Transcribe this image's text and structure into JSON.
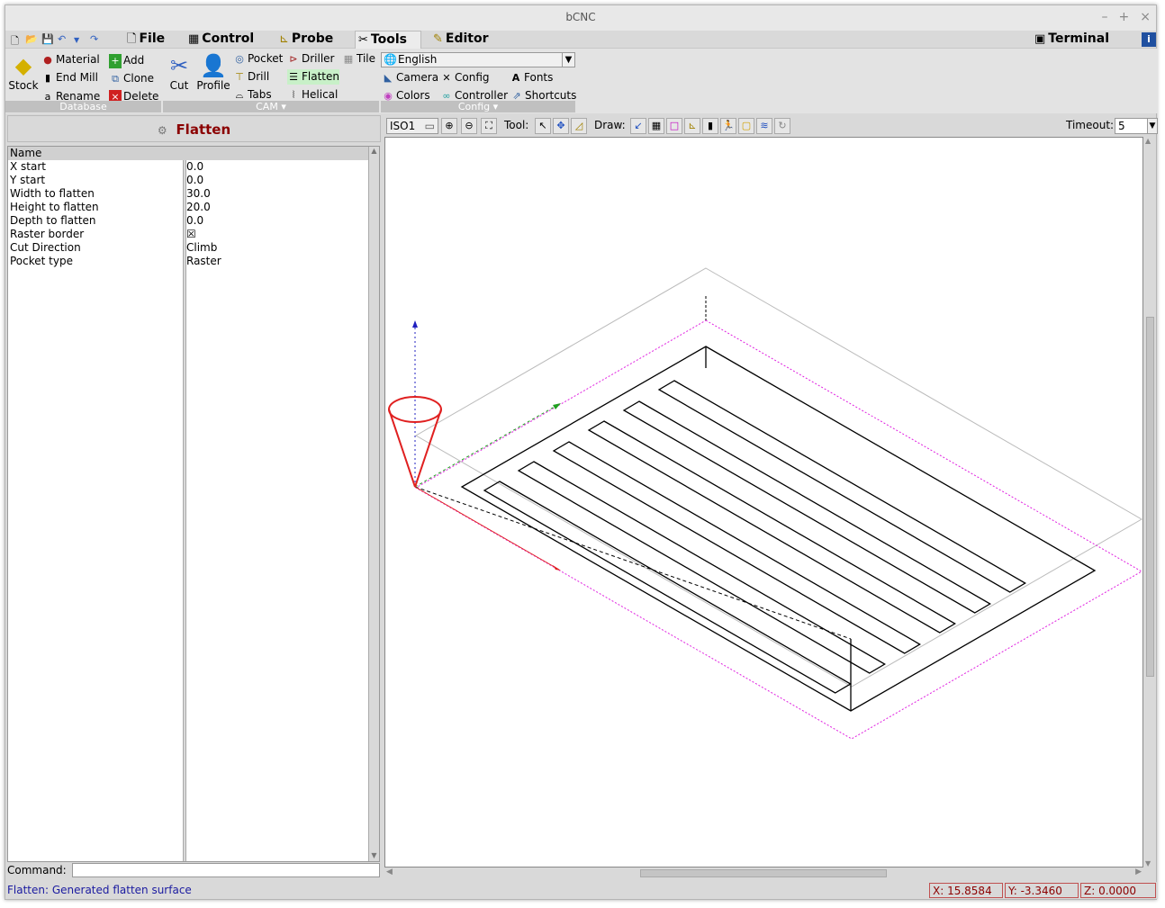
{
  "window": {
    "title": "bCNC"
  },
  "menu": {
    "tabs": [
      {
        "label": "File"
      },
      {
        "label": "Control"
      },
      {
        "label": "Probe"
      },
      {
        "label": "Tools"
      },
      {
        "label": "Editor"
      }
    ],
    "terminal": "Terminal"
  },
  "ribbon": {
    "database": {
      "group_label": "Database",
      "stock": "Stock",
      "material": "Material",
      "end_mill": "End Mill",
      "rename": "Rename",
      "add": "Add",
      "clone": "Clone",
      "delete": "Delete"
    },
    "cam": {
      "group_label": "CAM",
      "cut": "Cut",
      "profile": "Profile",
      "pocket": "Pocket",
      "drill": "Drill",
      "tabs": "Tabs",
      "driller": "Driller",
      "flatten": "Flatten",
      "helical": "Helical",
      "tile": "Tile"
    },
    "config": {
      "group_label": "Config",
      "language": "English",
      "camera": "Camera",
      "config": "Config",
      "fonts": "Fonts",
      "colors": "Colors",
      "controller": "Controller",
      "shortcuts": "Shortcuts"
    }
  },
  "tool_panel": {
    "title": "Flatten",
    "properties": [
      {
        "name": "Name",
        "value": ""
      },
      {
        "name": "X start",
        "value": "0.0"
      },
      {
        "name": "Y start",
        "value": "0.0"
      },
      {
        "name": "Width to flatten",
        "value": "30.0"
      },
      {
        "name": "Height to flatten",
        "value": "20.0"
      },
      {
        "name": "Depth to flatten",
        "value": "0.0"
      },
      {
        "name": "Raster border",
        "value": "☒"
      },
      {
        "name": "Cut Direction",
        "value": "Climb"
      },
      {
        "name": "Pocket type",
        "value": "Raster"
      }
    ]
  },
  "canvas_toolbar": {
    "view": "ISO1",
    "tool_label": "Tool:",
    "draw_label": "Draw:",
    "timeout_label": "Timeout:",
    "timeout_value": "5"
  },
  "command": {
    "label": "Command:",
    "value": ""
  },
  "status": {
    "message": "Flatten: Generated flatten surface",
    "x": "X: 15.8584",
    "y": "Y: -3.3460",
    "z": "Z: 0.0000"
  }
}
